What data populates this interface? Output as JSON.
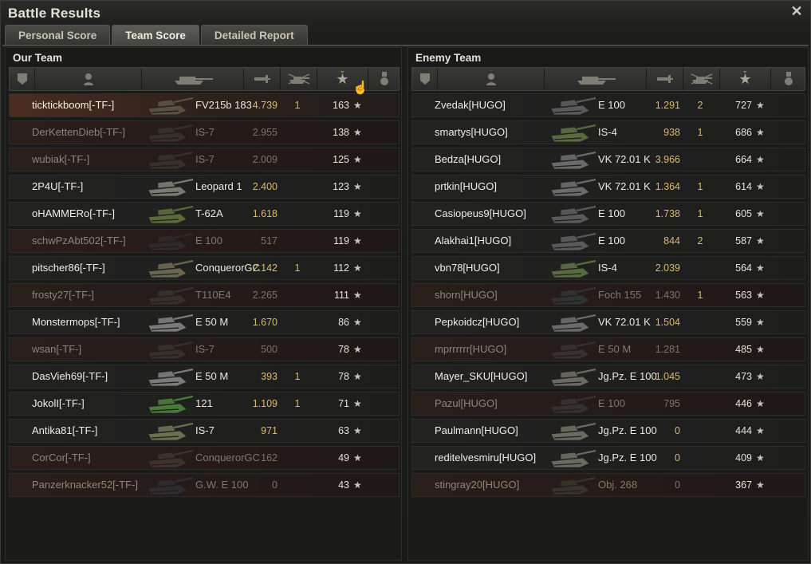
{
  "window": {
    "title": "Battle Results",
    "close_label": "✕"
  },
  "tabs": [
    {
      "label": "Personal Score",
      "active": false
    },
    {
      "label": "Team Score",
      "active": true
    },
    {
      "label": "Detailed Report",
      "active": false
    }
  ],
  "columns": [
    "rank-icon",
    "player-icon",
    "tank-icon",
    "damage-icon",
    "kills-icon",
    "xp-star-icon",
    "medal-icon"
  ],
  "our_team": {
    "title": "Our Team",
    "players": [
      {
        "name": "ticktickboom[-TF-]",
        "tank": "FV215b 183",
        "damage": "4.739",
        "kills": "1",
        "xp": "163",
        "status": "me",
        "color": "#5a5040"
      },
      {
        "name": "DerKettenDieb[-TF-]",
        "tank": "IS-7",
        "damage": "2.955",
        "kills": "",
        "xp": "138",
        "status": "dead",
        "color": "#4a4a40"
      },
      {
        "name": "wubiak[-TF-]",
        "tank": "IS-7",
        "damage": "2.009",
        "kills": "",
        "xp": "125",
        "status": "dead",
        "color": "#4a4a40"
      },
      {
        "name": "2P4U[-TF-]",
        "tank": "Leopard 1",
        "damage": "2.400",
        "kills": "",
        "xp": "123",
        "status": "alive",
        "color": "#7a7a70"
      },
      {
        "name": "oHAMMERo[-TF-]",
        "tank": "T-62A",
        "damage": "1.618",
        "kills": "",
        "xp": "119",
        "status": "alive",
        "color": "#5a6a3a"
      },
      {
        "name": "schwPzAbt502[-TF-]",
        "tank": "E 100",
        "damage": "517",
        "kills": "",
        "xp": "119",
        "status": "dead",
        "color": "#3a3a3a"
      },
      {
        "name": "pitscher86[-TF-]",
        "tank": "ConquerorGC",
        "damage": "2.142",
        "kills": "1",
        "xp": "112",
        "status": "alive",
        "color": "#6a6650"
      },
      {
        "name": "frosty27[-TF-]",
        "tank": "T110E4",
        "damage": "2.265",
        "kills": "",
        "xp": "111",
        "status": "dead",
        "color": "#4a4a40"
      },
      {
        "name": "Monstermops[-TF-]",
        "tank": "E 50 M",
        "damage": "1.670",
        "kills": "",
        "xp": "86",
        "status": "alive",
        "color": "#7a7a7a"
      },
      {
        "name": "wsan[-TF-]",
        "tank": "IS-7",
        "damage": "500",
        "kills": "",
        "xp": "78",
        "status": "dead",
        "color": "#4a4a40"
      },
      {
        "name": "DasVieh69[-TF-]",
        "tank": "E 50 M",
        "damage": "393",
        "kills": "1",
        "xp": "78",
        "status": "alive",
        "color": "#7a7a7a"
      },
      {
        "name": "JokolI[-TF-]",
        "tank": "121",
        "damage": "1.109",
        "kills": "1",
        "xp": "71",
        "status": "alive",
        "color": "#4a7a3a"
      },
      {
        "name": "Antika81[-TF-]",
        "tank": "IS-7",
        "damage": "971",
        "kills": "",
        "xp": "63",
        "status": "alive",
        "color": "#6a7050"
      },
      {
        "name": "CorCor[-TF-]",
        "tank": "ConquerorGC",
        "damage": "162",
        "kills": "",
        "xp": "49",
        "status": "dead",
        "color": "#5a5040"
      },
      {
        "name": "Panzerknacker52[-TF-]",
        "tank": "G.W. E 100",
        "damage": "0",
        "kills": "",
        "xp": "43",
        "status": "dead",
        "color": "#3a4050"
      }
    ]
  },
  "enemy_team": {
    "title": "Enemy Team",
    "players": [
      {
        "name": "Zvedak[HUGO]",
        "tank": "E 100",
        "damage": "1.291",
        "kills": "2",
        "xp": "727",
        "status": "alive",
        "color": "#5a5a5a"
      },
      {
        "name": "smartys[HUGO]",
        "tank": "IS-4",
        "damage": "938",
        "kills": "1",
        "xp": "686",
        "status": "alive",
        "color": "#5a6a40"
      },
      {
        "name": "Bedza[HUGO]",
        "tank": "VK 72.01 K",
        "damage": "3.966",
        "kills": "",
        "xp": "664",
        "status": "alive",
        "color": "#6a6a6a"
      },
      {
        "name": "prtkin[HUGO]",
        "tank": "VK 72.01 K",
        "damage": "1.364",
        "kills": "1",
        "xp": "614",
        "status": "alive",
        "color": "#6a6a6a"
      },
      {
        "name": "Casiopeus9[HUGO]",
        "tank": "E 100",
        "damage": "1.738",
        "kills": "1",
        "xp": "605",
        "status": "alive",
        "color": "#5a5a5a"
      },
      {
        "name": "Alakhai1[HUGO]",
        "tank": "E 100",
        "damage": "844",
        "kills": "2",
        "xp": "587",
        "status": "alive",
        "color": "#5a5a5a"
      },
      {
        "name": "vbn78[HUGO]",
        "tank": "IS-4",
        "damage": "2.039",
        "kills": "",
        "xp": "564",
        "status": "alive",
        "color": "#5a6a40"
      },
      {
        "name": "shorn[HUGO]",
        "tank": "Foch 155",
        "damage": "1.430",
        "kills": "1",
        "xp": "563",
        "status": "dead",
        "color": "#3a5050"
      },
      {
        "name": "Pepkoidcz[HUGO]",
        "tank": "VK 72.01 K",
        "damage": "1.504",
        "kills": "",
        "xp": "559",
        "status": "alive",
        "color": "#6a6a6a"
      },
      {
        "name": "mprrrrrr[HUGO]",
        "tank": "E 50 M",
        "damage": "1.281",
        "kills": "",
        "xp": "485",
        "status": "dead",
        "color": "#4a4a4a"
      },
      {
        "name": "Mayer_SKU[HUGO]",
        "tank": "Jg.Pz. E 100",
        "damage": "1.045",
        "kills": "",
        "xp": "473",
        "status": "alive",
        "color": "#6a6a60"
      },
      {
        "name": "Pazul[HUGO]",
        "tank": "E 100",
        "damage": "795",
        "kills": "",
        "xp": "446",
        "status": "dead",
        "color": "#4a4a4a"
      },
      {
        "name": "Paulmann[HUGO]",
        "tank": "Jg.Pz. E 100",
        "damage": "0",
        "kills": "",
        "xp": "444",
        "status": "alive",
        "color": "#6a6a60"
      },
      {
        "name": "reditelvesmiru[HUGO]",
        "tank": "Jg.Pz. E 100",
        "damage": "0",
        "kills": "",
        "xp": "409",
        "status": "alive",
        "color": "#6a6a60"
      },
      {
        "name": "stingray20[HUGO]",
        "tank": "Obj. 268",
        "damage": "0",
        "kills": "",
        "xp": "367",
        "status": "dead",
        "color": "#4a5040"
      }
    ]
  },
  "star_glyph": "★"
}
